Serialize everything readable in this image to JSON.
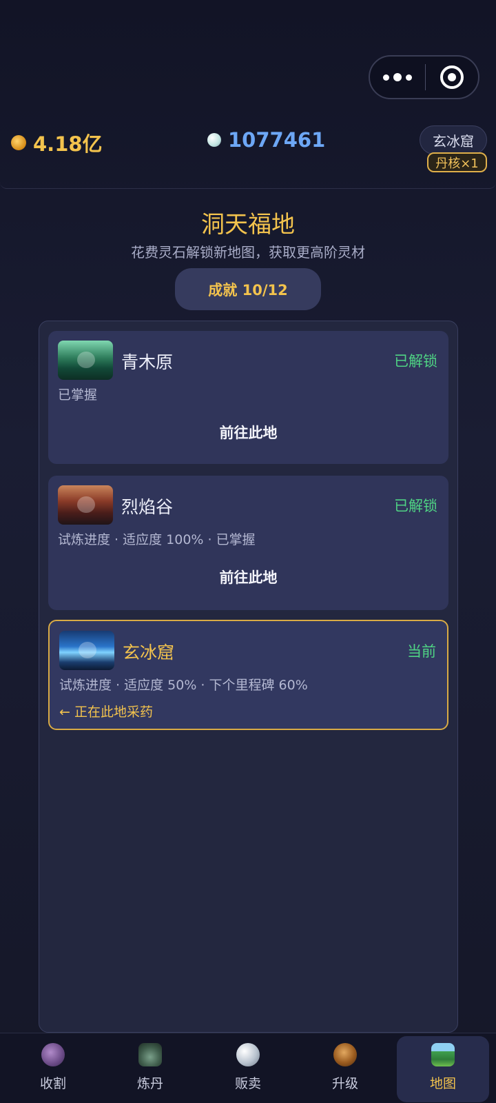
{
  "resources": {
    "spirit_stone": "4.18亿",
    "pearl": "1077461"
  },
  "location": {
    "current": "玄冰窟",
    "core": "丹核×1"
  },
  "header": {
    "title": "洞天福地",
    "subtitle": "花费灵石解锁新地图，获取更高阶灵材",
    "achievement": "成就 10/12"
  },
  "maps": [
    {
      "name": "青木原",
      "status": "已解锁",
      "meta": "已掌握",
      "action": "前往此地",
      "thumb_icon": "forest-map-icon"
    },
    {
      "name": "烈焰谷",
      "status": "已解锁",
      "meta": "试炼进度 · 适应度 100% · 已掌握",
      "action": "前往此地",
      "thumb_icon": "fire-valley-map-icon"
    },
    {
      "name": "玄冰窟",
      "status": "当前",
      "meta": "试炼进度 · 适应度 50% · 下个里程碑 60%",
      "here": "← 正在此地采药",
      "thumb_icon": "ice-cave-map-icon"
    }
  ],
  "tabs": [
    {
      "label": "收割",
      "icon": "harvest-icon"
    },
    {
      "label": "炼丹",
      "icon": "alchemy-icon"
    },
    {
      "label": "贩卖",
      "icon": "sell-icon"
    },
    {
      "label": "升级",
      "icon": "upgrade-icon"
    },
    {
      "label": "地图",
      "icon": "map-icon",
      "active": true
    }
  ],
  "colors": {
    "accent_gold": "#f3c34d",
    "status_green": "#4fd484",
    "pearl_blue": "#6da7f5",
    "background": "#151728"
  }
}
